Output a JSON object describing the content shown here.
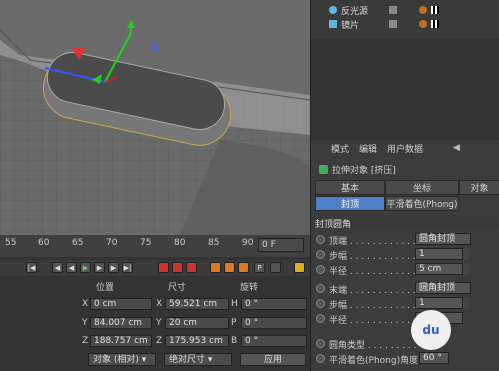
{
  "object_manager": {
    "rows": [
      {
        "name": "反光源"
      },
      {
        "name": "镜片"
      }
    ]
  },
  "attributes": {
    "menu": [
      "模式",
      "编辑",
      "用户数据"
    ],
    "object_title": "拉伸对象 [挤压]",
    "tabs_row1": [
      "基本",
      "坐标",
      "对象"
    ],
    "tabs_row2": [
      "封顶",
      "平滑着色(Phong)"
    ],
    "section": "封顶圆角",
    "params": [
      {
        "label": "顶端 . . . . . . . . . . . .",
        "value": "圆角封顶"
      },
      {
        "label": "步幅 . . . . . . . . . . . .",
        "value": "1"
      },
      {
        "label": "半径 . . . . . . . . . . . .",
        "value": "5 cm"
      },
      {
        "label": "末端 . . . . . . . . . . . .",
        "value": "圆角封顶"
      },
      {
        "label": "步幅 . . . . . . . . . . . .",
        "value": "1"
      },
      {
        "label": "半径 . . . . . . . . . . . .",
        "value": ""
      },
      {
        "label": "圆角类型 . . . . . . . . .",
        "value": ""
      },
      {
        "label": "平滑着色(Phong)角度",
        "value": "60 °"
      }
    ]
  },
  "timeline": {
    "ticks": [
      "55",
      "60",
      "65",
      "70",
      "75",
      "80",
      "85",
      "90"
    ],
    "frame_field": "0 F"
  },
  "coordinates": {
    "headers": [
      "位置",
      "尺寸",
      "旋转"
    ],
    "rows": [
      {
        "axis": "X",
        "pos": "0 cm",
        "size_axis": "X",
        "size": "59.521 cm",
        "rot_axis": "H",
        "rot": "0 °"
      },
      {
        "axis": "Y",
        "pos": "84.007 cm",
        "size_axis": "Y",
        "size": "20 cm",
        "rot_axis": "P",
        "rot": "0 °"
      },
      {
        "axis": "Z",
        "pos": "188.757 cm",
        "size_axis": "Z",
        "size": "175.953 cm",
        "rot_axis": "B",
        "rot": "0 °"
      }
    ],
    "mode_dropdown": "对象 (相对)",
    "size_dropdown": "绝对尺寸",
    "apply_button": "应用"
  },
  "watermark": "du"
}
